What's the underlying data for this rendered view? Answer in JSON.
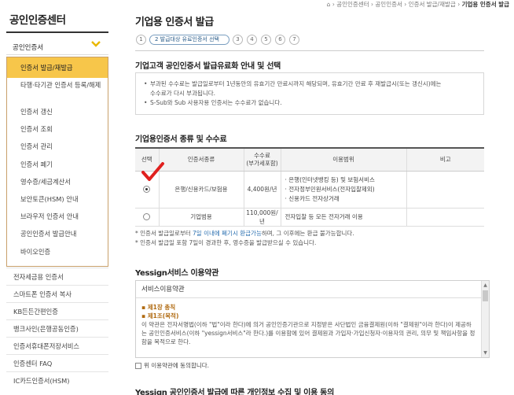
{
  "sidebar": {
    "title": "공인인증센터",
    "category": "공인인증서",
    "submenu": [
      "인증서 발급/재발급",
      "타행·타기관 인증서 등록/해제",
      "인증서 갱신",
      "인증서 조회",
      "인증서 관리",
      "인증서 폐기",
      "영수증/세금계산서",
      "보안토큰(HSM) 안내",
      "브라우저 인증서 안내",
      "공인인증서 발급안내",
      "바이오인증"
    ],
    "menu": [
      "전자세금용 인증서",
      "스마트폰 인증서 복사",
      "KB든든간편인증",
      "뱅크사인(은행공동인증)",
      "인증서휴대폰저장서비스",
      "인증센터 FAQ",
      "IC카드인증서(HSM)"
    ]
  },
  "breadcrumb": [
    "공인인증센터",
    "공인인증서",
    "인증서 발급/재발급",
    "기업용 인증서 발급"
  ],
  "page_title": "기업용 인증서 발급",
  "steps": {
    "labels": [
      "1",
      "2 발급대상 유료인증서 선택",
      "3",
      "4",
      "5",
      "6",
      "7"
    ],
    "active_index": 1
  },
  "section1": {
    "title": "기업고객 공인인증서 발급유료화 안내 및 선택",
    "lines": [
      "부과된 수수료는 발급일로부터 1년동안의 유효기간 만료시까지 해당되며, 유효기간 만료 후 재발급시(또는 갱신시)에는",
      "수수료가 다시 부과됩니다.",
      "S-Sub와 Sub 사용자용 인증서는 수수료가 없습니다."
    ]
  },
  "section2": {
    "title": "기업용인증서 종류 및 수수료",
    "headers": [
      "선택",
      "인증서종류",
      "수수료\n(부가세포함)",
      "이용범위",
      "비고"
    ],
    "rows": [
      {
        "selected": true,
        "type": "은행/신용카드/보험용",
        "fee": "4,400원/년",
        "scope": [
          "· 은행(인터넷뱅킹 등) 및 보험서비스",
          "· 전자정부민원서비스(전자입찰제외)",
          "· 신용카드 전자상거래"
        ],
        "note": ""
      },
      {
        "selected": false,
        "type": "기업범용",
        "fee": "110,000원/년",
        "scope": [
          "전자입찰 등 모든 전자거래 이용"
        ],
        "note": ""
      }
    ],
    "notes": {
      "note1_pre": "인증서 발급일로부터 ",
      "note1_hl": "7일 이내에 폐기시 환급가능",
      "note1_post": "하며, 그 이후에는 환급 불가능합니다.",
      "note2": "인증서 발급일 포함 7일이 경과한 후, 영수증을 발급받으실 수 있습니다."
    }
  },
  "section3": {
    "title": "Yessign서비스 이용약관",
    "box_title": "서비스이용약관",
    "chapter": "제1장 총칙",
    "article": "제1조(목적)",
    "body": "이 약관은 전자서명법(이하 \"법\"이라 한다)에 의거 공인인증기관으로 지정받은 사단법인 금융결제원(이하 \"결제원\"이라 한다)이 제공하는 공인인증서비스(이하 \"yessign서비스\"라 한다.)를 이용함에 있어 결제원과 가입자·가입신청자·이용자의 권리, 의무 및 책임사항을 정함을 목적으로 한다.",
    "agree_label": "위 이용약관에 동의합니다."
  },
  "section4": {
    "title": "Yessign 공인인증서 발급에 따른 개인정보 수집 및 이용 동의"
  },
  "colors": {
    "active_menu": "#f7c64a",
    "submenu_border": "#c8a06a",
    "checkmark": "#e0201e",
    "link": "#2a6fb0"
  }
}
